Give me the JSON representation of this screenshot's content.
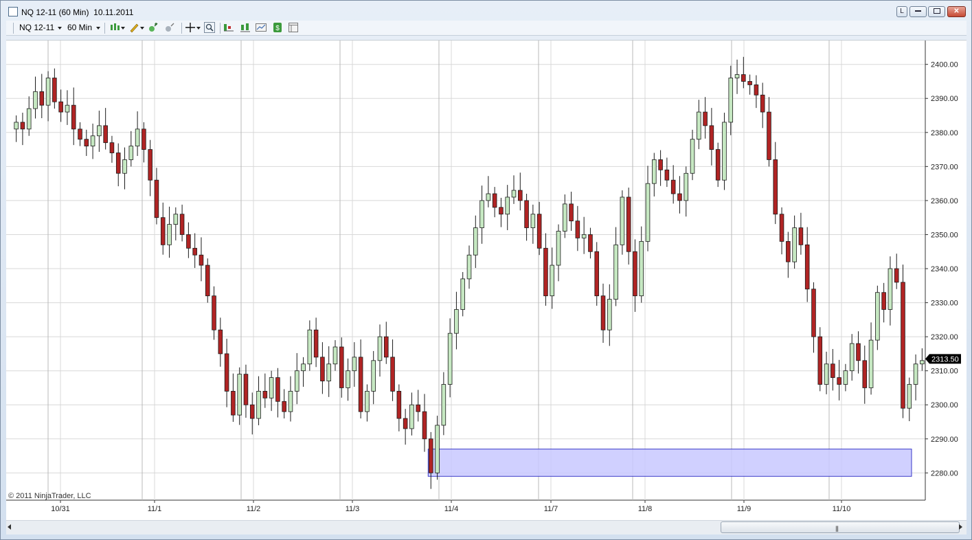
{
  "window": {
    "title": "NQ 12-11 (60 Min)  10.11.2011",
    "buttons": [
      "L",
      "",
      "",
      "✕"
    ]
  },
  "toolbar": {
    "instrument": "NQ 12-11",
    "interval": "60 Min",
    "icons": [
      "candlestick-chart-icon",
      "pencil-draw-icon",
      "zoom-in-icon",
      "zoom-out-icon",
      "crosshair-icon",
      "magnifier-icon",
      "indicators-icon",
      "strategies-icon",
      "chart-properties-icon",
      "dollar-icon",
      "data-box-icon"
    ]
  },
  "chart": {
    "copyright": "© 2011 NinjaTrader, LLC",
    "last_price_label": "2313.50",
    "colors": {
      "up": "#c6e8c2",
      "down": "#b02424",
      "wick": "#1a1a1a",
      "zone_fill": "#c8c8ff",
      "zone_stroke": "#3a3ac8",
      "grid": "#d8d8d8",
      "session": "#b8b8b8",
      "price_badge": "#000000"
    }
  },
  "chart_data": {
    "type": "candlestick",
    "y_range": [
      2272,
      2407
    ],
    "y_ticks": [
      "2400.00",
      "2390.00",
      "2380.00",
      "2370.00",
      "2360.00",
      "2350.00",
      "2340.00",
      "2330.00",
      "2320.00",
      "2310.00",
      "2300.00",
      "2290.00",
      "2280.00"
    ],
    "x_labels": [
      "10/31",
      "11/1",
      "11/2",
      "11/3",
      "11/4",
      "11/7",
      "11/8",
      "11/9",
      "11/10"
    ],
    "series_close": [
      2383,
      2381,
      2387,
      2392,
      2388,
      2396,
      2389,
      2386,
      2388,
      2381,
      2378,
      2376,
      2379,
      2382,
      2377,
      2374,
      2368,
      2372,
      2376,
      2381,
      2375,
      2366,
      2355,
      2347,
      2353,
      2356,
      2350,
      2346,
      2344,
      2341,
      2332,
      2322,
      2315,
      2304,
      2297,
      2309,
      2300,
      2296,
      2304,
      2302,
      2308,
      2301,
      2298,
      2304,
      2310,
      2312,
      2322,
      2314,
      2307,
      2312,
      2317,
      2305,
      2310,
      2314,
      2298,
      2304,
      2313,
      2320,
      2314,
      2304,
      2296,
      2293,
      2300,
      2298,
      2290,
      2280,
      2294,
      2306,
      2321,
      2328,
      2337,
      2344,
      2352,
      2360,
      2362,
      2358,
      2356,
      2361,
      2363,
      2360,
      2352,
      2356,
      2346,
      2332,
      2341,
      2351,
      2359,
      2354,
      2349,
      2350,
      2345,
      2332,
      2322,
      2331,
      2347,
      2361,
      2345,
      2332,
      2348,
      2365,
      2372,
      2369,
      2366,
      2362,
      2360,
      2368,
      2378,
      2386,
      2382,
      2375,
      2366,
      2383,
      2396,
      2397,
      2395,
      2394,
      2391,
      2386,
      2372,
      2356,
      2348,
      2342,
      2352,
      2347,
      2334,
      2320,
      2306,
      2312,
      2308,
      2306,
      2310,
      2318,
      2313,
      2305,
      2319,
      2333,
      2328,
      2340,
      2336,
      2299,
      2306,
      2312,
      2313
    ],
    "highlight_zone": {
      "from_price": 2287,
      "to_price": 2279,
      "start_bar": 65,
      "end_bar": 160
    },
    "last_price": 2313.5
  }
}
